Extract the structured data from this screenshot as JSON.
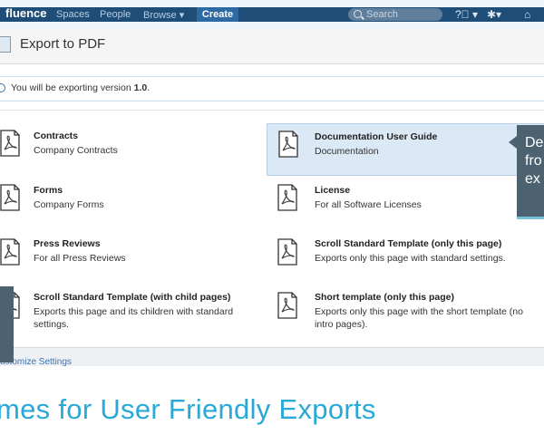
{
  "topbar": {
    "brand": "fluence",
    "nav": [
      "Spaces",
      "People",
      "Browse ▾"
    ],
    "create_label": "Create",
    "search_placeholder": "Search",
    "help_icon": "help-icon",
    "settings_icon": "gear-icon",
    "notifications_icon": "notifications-icon"
  },
  "dialog": {
    "title": "Export to PDF",
    "info_prefix": "You will be exporting version ",
    "info_version": "1.0",
    "info_suffix": "."
  },
  "templates": [
    {
      "name": "Contracts",
      "desc": "Company Contracts",
      "selected": false
    },
    {
      "name": "Documentation User Guide",
      "desc": "Documentation",
      "selected": true
    },
    {
      "name": "Forms",
      "desc": "Company Forms",
      "selected": false
    },
    {
      "name": "License",
      "desc": "For all Software Licenses",
      "selected": false
    },
    {
      "name": "Press Reviews",
      "desc": "For all Press Reviews",
      "selected": false
    },
    {
      "name": "Scroll Standard Template (only this page)",
      "desc": "Exports only this page with standard settings.",
      "selected": false
    },
    {
      "name": "Scroll Standard Template (with child pages)",
      "desc_lines": [
        "Exports this page and its children with standard",
        "settings."
      ],
      "selected": false
    },
    {
      "name": "Short template (only this page)",
      "desc_lines": [
        "Exports only this page with the short template (no",
        "intro pages)."
      ],
      "selected": false
    }
  ],
  "footer": {
    "customize_link": "ustomize Settings"
  },
  "callout": {
    "lines": [
      "De",
      "fro",
      "ex"
    ]
  },
  "headline": "mes for User Friendly Exports",
  "colors": {
    "nav_bar": "#1e4d78",
    "selected_bg": "#dbe9f6",
    "callout_bg": "#4d6270",
    "headline": "#2aa8d6",
    "link": "#3b73af"
  }
}
